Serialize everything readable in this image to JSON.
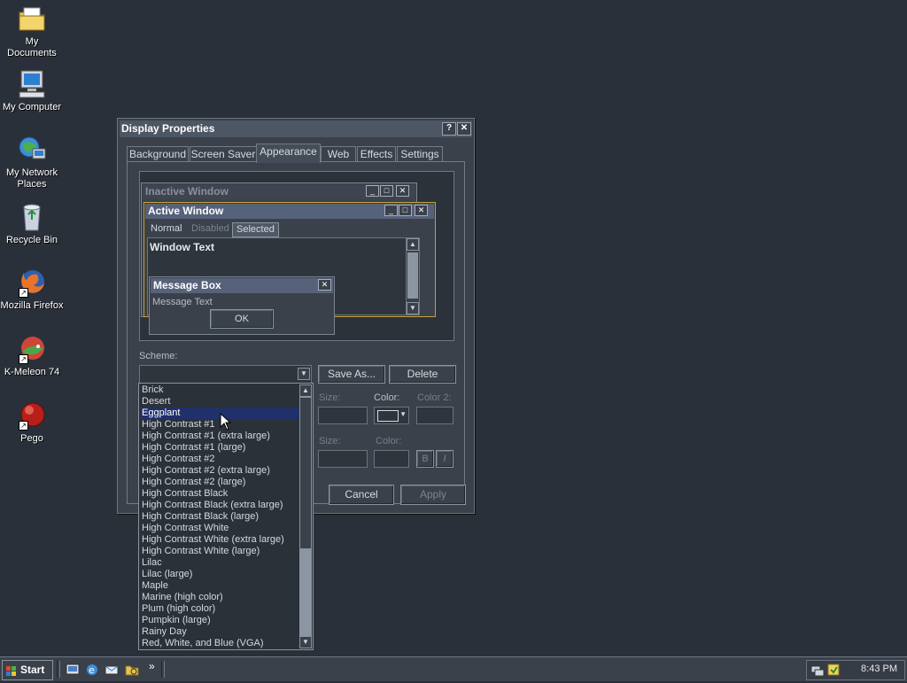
{
  "desktop": {
    "icons": [
      {
        "label": "My Documents",
        "icon": "folder-icon"
      },
      {
        "label": "My Computer",
        "icon": "computer-icon"
      },
      {
        "label": "My Network Places",
        "icon": "network-icon"
      },
      {
        "label": "Recycle Bin",
        "icon": "recycle-bin-icon"
      },
      {
        "label": "Mozilla Firefox",
        "icon": "firefox-icon"
      },
      {
        "label": "K-Meleon 74",
        "icon": "kmeleon-icon"
      },
      {
        "label": "Pego",
        "icon": "pego-icon"
      }
    ]
  },
  "dialog": {
    "title": "Display Properties",
    "help": "?",
    "close": "✕",
    "tabs": [
      "Background",
      "Screen Saver",
      "Appearance",
      "Web",
      "Effects",
      "Settings"
    ],
    "active_tab": "Appearance",
    "preview": {
      "inactive_title": "Inactive Window",
      "active_title": "Active Window",
      "menu": [
        "Normal",
        "Disabled",
        "Selected"
      ],
      "window_text": "Window Text",
      "msgbox_title": "Message Box",
      "msgbox_text": "Message Text",
      "ok": "OK"
    },
    "scheme_label": "Scheme:",
    "scheme_value": "",
    "save_as": "Save As...",
    "delete": "Delete",
    "size_label": "Size:",
    "color_label": "Color:",
    "color2_label": "Color 2:",
    "size2_label": "Size:",
    "color3_label": "Color:",
    "bold": "B",
    "italic": "I",
    "cancel": "Cancel",
    "apply": "Apply"
  },
  "scheme_list": {
    "selected": "Eggplant",
    "items": [
      "Brick",
      "Desert",
      "Eggplant",
      "High Contrast #1",
      "High Contrast #1 (extra large)",
      "High Contrast #1 (large)",
      "High Contrast #2",
      "High Contrast #2 (extra large)",
      "High Contrast #2 (large)",
      "High Contrast Black",
      "High Contrast Black (extra large)",
      "High Contrast Black (large)",
      "High Contrast White",
      "High Contrast White (extra large)",
      "High Contrast White (large)",
      "Lilac",
      "Lilac (large)",
      "Maple",
      "Marine (high color)",
      "Plum (high color)",
      "Pumpkin (large)",
      "Rainy Day",
      "Red, White, and Blue (VGA)"
    ]
  },
  "taskbar": {
    "start": "Start",
    "clock": "8:43 PM",
    "more": "»"
  },
  "colors": {
    "desktop": "#2a3039",
    "dialog": "#3a414b",
    "selection": "#20306b"
  }
}
